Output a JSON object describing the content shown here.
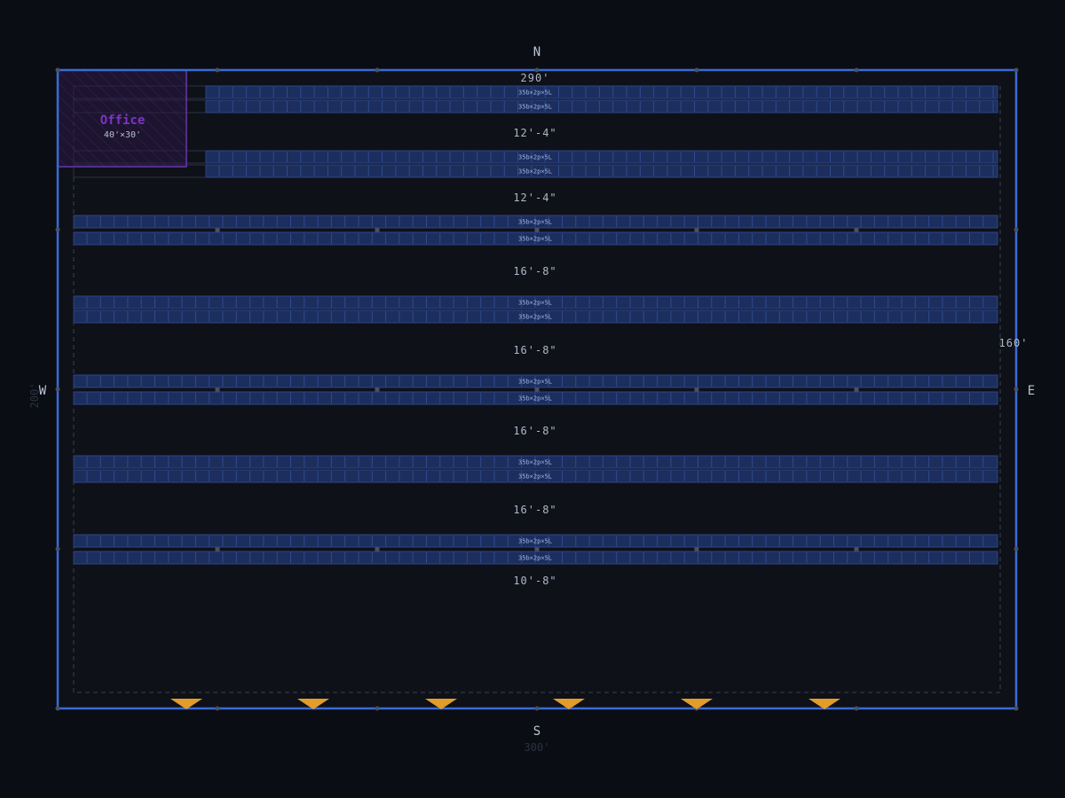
{
  "compass": {
    "north": "N",
    "south": "S",
    "west": "W",
    "east": "E"
  },
  "dimensions": {
    "inner_width": "290'",
    "outer_width": "300'",
    "inner_height": "160'",
    "outer_height": "200'"
  },
  "office": {
    "title": "Office",
    "size": "40'×30'"
  },
  "rack_label": "35b×2p×5L",
  "aisles": [
    "12'-4\"",
    "12'-4\"",
    "16'-8\"",
    "16'-8\"",
    "16'-8\"",
    "16'-8\"",
    "10'-8\""
  ],
  "rack_row_count": 14,
  "dock_door_count": 6,
  "colors": {
    "background": "#0a0d13",
    "building_fill": "#0e1118",
    "wall": "#3a6bd6",
    "rack_fill": "#1c2e5e",
    "rack_edge": "#2d4587",
    "office": "#7b35c4",
    "dock_door": "#e39c2a"
  }
}
